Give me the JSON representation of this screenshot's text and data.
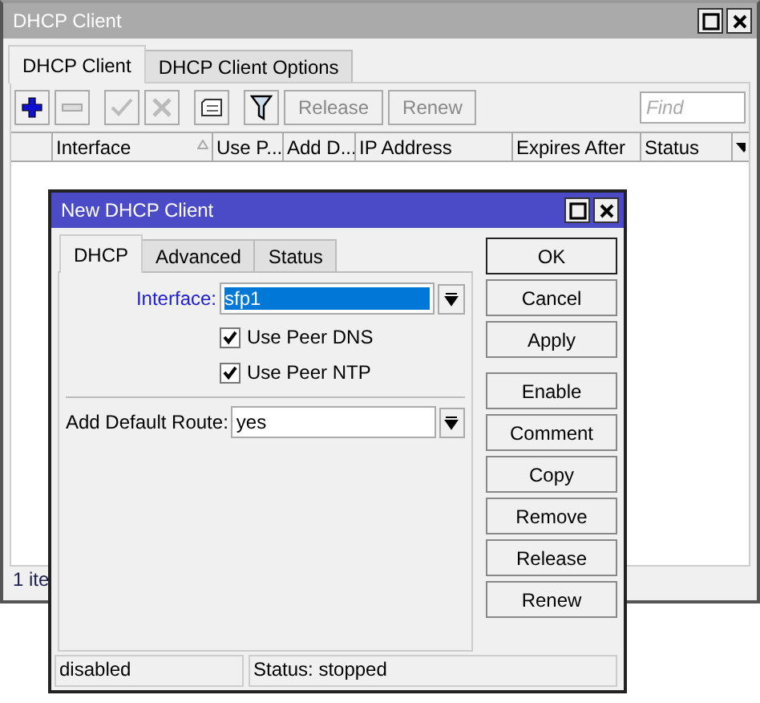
{
  "window": {
    "title": "DHCP Client"
  },
  "tabs": [
    {
      "label": "DHCP Client",
      "selected": true
    },
    {
      "label": "DHCP Client Options",
      "selected": false
    }
  ],
  "toolbar": [
    {
      "kind": "add",
      "disabled": false
    },
    {
      "kind": "remove",
      "disabled": true
    },
    {
      "kind": "enable",
      "disabled": true
    },
    {
      "kind": "disable",
      "disabled": true
    },
    {
      "kind": "comment",
      "disabled": false
    },
    {
      "kind": "filter",
      "disabled": false
    },
    {
      "kind": "text",
      "label": "Release",
      "disabled": true
    },
    {
      "kind": "text",
      "label": "Renew",
      "disabled": true
    }
  ],
  "search": {
    "placeholder": "Find"
  },
  "table": {
    "columns": [
      "Interface",
      "Use P...",
      "Add D...",
      "IP Address",
      "Expires After",
      "Status"
    ]
  },
  "status_bar": "1 ite",
  "dialog": {
    "title": "New DHCP Client",
    "tabs": [
      {
        "label": "DHCP",
        "selected": true
      },
      {
        "label": "Advanced",
        "selected": false
      },
      {
        "label": "Status",
        "selected": false
      }
    ],
    "interface": {
      "label": "Interface:",
      "value": "sfp1"
    },
    "checkboxes": [
      {
        "label": "Use Peer DNS",
        "checked": true
      },
      {
        "label": "Use Peer NTP",
        "checked": true
      }
    ],
    "default_route": {
      "label": "Add Default Route:",
      "value": "yes"
    },
    "buttons": [
      "OK",
      "Cancel",
      "Apply",
      "Enable",
      "Comment",
      "Copy",
      "Remove",
      "Release",
      "Renew"
    ],
    "status_bar": [
      "disabled",
      "Status: stopped"
    ]
  }
}
